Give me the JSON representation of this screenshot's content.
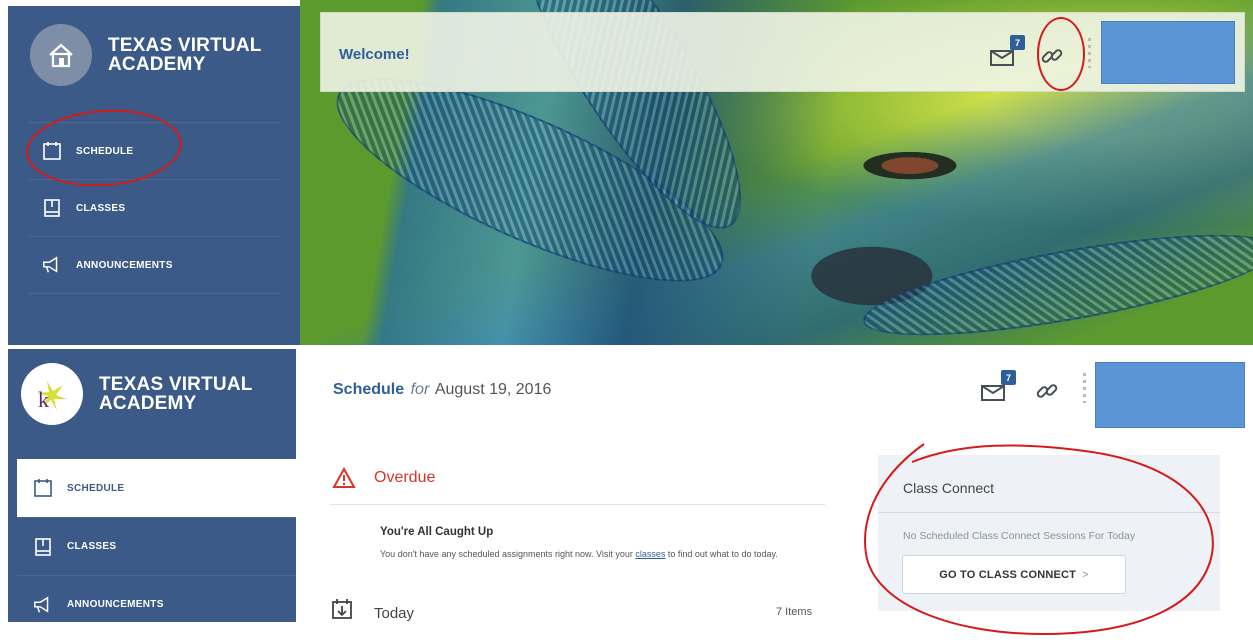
{
  "brand": {
    "line1": "TEXAS VIRTUAL",
    "line2": "ACADEMY"
  },
  "nav": {
    "schedule": "SCHEDULE",
    "classes": "CLASSES",
    "announcements": "ANNOUNCEMENTS"
  },
  "header": {
    "welcome": "Welcome!",
    "mail_badge": "7"
  },
  "schedule": {
    "title": "Schedule",
    "for_word": "for",
    "date": "August 19, 2016",
    "overdue": "Overdue",
    "caught_up_title": "You're All Caught Up",
    "caught_up_text_before": "You don't have any scheduled assignments right now. Visit your ",
    "caught_up_link": "classes",
    "caught_up_text_after": " to find out what to do today.",
    "today_label": "Today",
    "today_count": "7 Items"
  },
  "class_connect": {
    "title": "Class Connect",
    "empty_text": "No Scheduled Class Connect Sessions For Today",
    "button_label": "GO TO CLASS CONNECT",
    "button_chevron": ">"
  },
  "colors": {
    "sidebar": "#3c5a87",
    "accent_blue": "#2f5f9a",
    "alert_red": "#d6342c",
    "annotation_red": "#d61a1a",
    "redacted_box": "#5b95d6"
  },
  "icons": [
    "home-icon",
    "calendar-icon",
    "book-icon",
    "megaphone-icon",
    "mail-icon",
    "link-icon",
    "warning-icon",
    "calendar-download-icon",
    "k-logo-icon"
  ]
}
